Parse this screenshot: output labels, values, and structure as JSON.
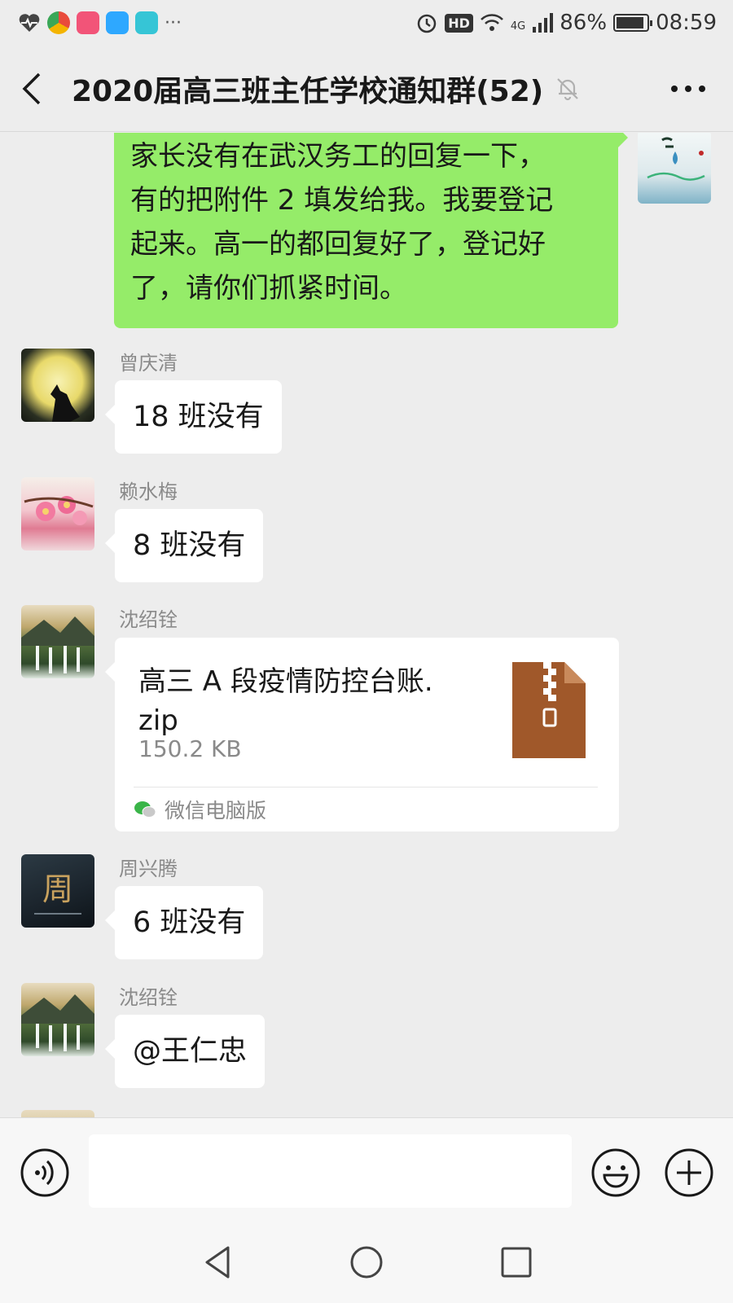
{
  "status_bar": {
    "battery": "86%",
    "time": "08:59",
    "network": "4G",
    "hd": "HD",
    "more_dots": "···"
  },
  "title_bar": {
    "title": "2020届高三班主任学校通知群(52)",
    "icons": [
      "back-icon",
      "mute-bell-icon",
      "more-icon"
    ]
  },
  "messages": [
    {
      "type": "text",
      "self": true,
      "lines": [
        "家长没有在武汉务工的回复一下，",
        "有的把附件 2 填发给我。我要登记",
        "起来。高一的都回复好了，登记好",
        "了，请你们抓紧时间。"
      ]
    },
    {
      "type": "text",
      "sender": "曾庆清",
      "text": "18 班没有"
    },
    {
      "type": "text",
      "sender": "赖水梅",
      "text": "8 班没有"
    },
    {
      "type": "file",
      "sender": "沈绍铨",
      "file_name_line1": "高三 A 段疫情防控台账.",
      "file_name_line2": "zip",
      "file_size": "150.2 KB",
      "source": "微信电脑版"
    },
    {
      "type": "text",
      "sender": "周兴腾",
      "text": "6 班没有"
    },
    {
      "type": "text",
      "sender": "沈绍铨",
      "text": "@王仁忠"
    }
  ],
  "input_bar": {
    "value": "",
    "icons": [
      "voice-icon",
      "emoji-icon",
      "plus-icon"
    ]
  },
  "nav_bar": {
    "icons": [
      "nav-back-icon",
      "nav-home-icon",
      "nav-recents-icon"
    ]
  },
  "colors": {
    "background": "#ededed",
    "self_bubble": "#95ec69",
    "other_bubble": "#ffffff",
    "file_icon": "#a0582a"
  }
}
